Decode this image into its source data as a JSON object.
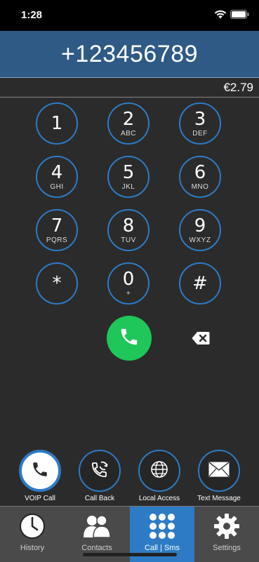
{
  "status_bar": {
    "time": "1:28",
    "icons": [
      "wifi-icon",
      "battery-icon"
    ]
  },
  "dialer": {
    "number": "+123456789",
    "balance": "€2.79"
  },
  "keypad": [
    {
      "digit": "1",
      "letters": ""
    },
    {
      "digit": "2",
      "letters": "ABC"
    },
    {
      "digit": "3",
      "letters": "DEF"
    },
    {
      "digit": "4",
      "letters": "GHI"
    },
    {
      "digit": "5",
      "letters": "JKL"
    },
    {
      "digit": "6",
      "letters": "MNO"
    },
    {
      "digit": "7",
      "letters": "PQRS"
    },
    {
      "digit": "8",
      "letters": "TUV"
    },
    {
      "digit": "9",
      "letters": "WXYZ"
    },
    {
      "digit": "*",
      "letters": ""
    },
    {
      "digit": "0",
      "letters": "+"
    },
    {
      "digit": "#",
      "letters": ""
    }
  ],
  "actions": [
    {
      "label": "VOIP Call",
      "icon": "phone-icon",
      "active": true
    },
    {
      "label": "Call Back",
      "icon": "callback-icon",
      "active": false
    },
    {
      "label": "Local Access",
      "icon": "globe-icon",
      "active": false
    },
    {
      "label": "Text Message",
      "icon": "envelope-icon",
      "active": false
    }
  ],
  "tabs": [
    {
      "label": "History",
      "icon": "clock-icon",
      "active": false
    },
    {
      "label": "Contacts",
      "icon": "contacts-icon",
      "active": false
    },
    {
      "label": "Call | Sms",
      "icon": "keypad-icon",
      "active": true
    },
    {
      "label": "Settings",
      "icon": "gear-icon",
      "active": false
    }
  ],
  "colors": {
    "accent": "#2d7bc4",
    "call_green": "#1fc65a",
    "number_bar": "#2f5a86",
    "background": "#2b2b2b"
  }
}
